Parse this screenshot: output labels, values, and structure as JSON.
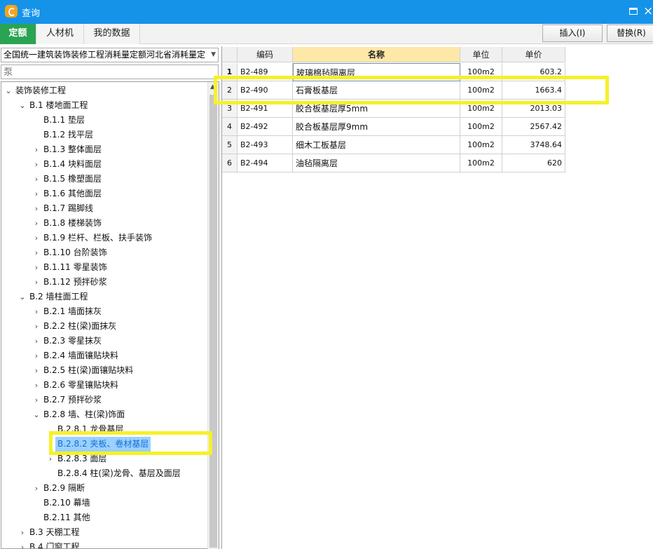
{
  "window": {
    "title": "查询"
  },
  "tabs": [
    "定额",
    "人材机",
    "我的数据"
  ],
  "buttons": {
    "insert": "插入(I)",
    "replace": "替换(R)"
  },
  "library": {
    "selected": "全国统一建筑装饰装修工程消耗量定额河北省消耗量定"
  },
  "search": {
    "value": "",
    "placeholder": "泵"
  },
  "tree": [
    {
      "label": "装饰装修工程",
      "level": 0,
      "arrow": "down"
    },
    {
      "label": "B.1 楼地面工程",
      "level": 1,
      "arrow": "down"
    },
    {
      "label": "B.1.1 垫层",
      "level": 2,
      "arrow": "none"
    },
    {
      "label": "B.1.2 找平层",
      "level": 2,
      "arrow": "none"
    },
    {
      "label": "B.1.3 整体面层",
      "level": 2,
      "arrow": "right"
    },
    {
      "label": "B.1.4 块料面层",
      "level": 2,
      "arrow": "right"
    },
    {
      "label": "B.1.5 橡塑面层",
      "level": 2,
      "arrow": "right"
    },
    {
      "label": "B.1.6 其他面层",
      "level": 2,
      "arrow": "right"
    },
    {
      "label": "B.1.7 踢脚线",
      "level": 2,
      "arrow": "right"
    },
    {
      "label": "B.1.8 楼梯装饰",
      "level": 2,
      "arrow": "right"
    },
    {
      "label": "B.1.9 栏杆、栏板、扶手装饰",
      "level": 2,
      "arrow": "right"
    },
    {
      "label": "B.1.10 台阶装饰",
      "level": 2,
      "arrow": "right"
    },
    {
      "label": "B.1.11 零星装饰",
      "level": 2,
      "arrow": "right"
    },
    {
      "label": "B.1.12 预拌砂浆",
      "level": 2,
      "arrow": "right"
    },
    {
      "label": "B.2 墙柱面工程",
      "level": 1,
      "arrow": "down"
    },
    {
      "label": "B.2.1 墙面抹灰",
      "level": 2,
      "arrow": "right"
    },
    {
      "label": "B.2.2 柱(梁)面抹灰",
      "level": 2,
      "arrow": "right"
    },
    {
      "label": "B.2.3 零星抹灰",
      "level": 2,
      "arrow": "right"
    },
    {
      "label": "B.2.4 墙面镶贴块料",
      "level": 2,
      "arrow": "right"
    },
    {
      "label": "B.2.5 柱(梁)面镶贴块料",
      "level": 2,
      "arrow": "right"
    },
    {
      "label": "B.2.6 零星镶贴块料",
      "level": 2,
      "arrow": "right"
    },
    {
      "label": "B.2.7 预拌砂浆",
      "level": 2,
      "arrow": "right"
    },
    {
      "label": "B.2.8 墙、柱(梁)饰面",
      "level": 2,
      "arrow": "down"
    },
    {
      "label": "B.2.8.1 龙骨基层",
      "level": 3,
      "arrow": "none"
    },
    {
      "label": "B.2.8.2 夹板、卷材基层",
      "level": 3,
      "arrow": "none",
      "selected": true
    },
    {
      "label": "B.2.8.3 面层",
      "level": 3,
      "arrow": "right"
    },
    {
      "label": "B.2.8.4 柱(梁)龙骨、基层及面层",
      "level": 3,
      "arrow": "none"
    },
    {
      "label": "B.2.9 隔断",
      "level": 2,
      "arrow": "right"
    },
    {
      "label": "B.2.10 幕墙",
      "level": 2,
      "arrow": "none"
    },
    {
      "label": "B.2.11 其他",
      "level": 2,
      "arrow": "none"
    },
    {
      "label": "B.3 天棚工程",
      "level": 1,
      "arrow": "right"
    },
    {
      "label": "B.4 门窗工程",
      "level": 1,
      "arrow": "right"
    }
  ],
  "table": {
    "columns": [
      "编码",
      "名称",
      "单位",
      "单价"
    ],
    "rows": [
      {
        "no": "1",
        "code": "B2-489",
        "name": "玻璃棉毡隔离层",
        "unit": "100m2",
        "price": "603.2"
      },
      {
        "no": "2",
        "code": "B2-490",
        "name": "石膏板基层",
        "unit": "100m2",
        "price": "1663.4"
      },
      {
        "no": "3",
        "code": "B2-491",
        "name": "胶合板基层厚5mm",
        "unit": "100m2",
        "price": "2013.03"
      },
      {
        "no": "4",
        "code": "B2-492",
        "name": "胶合板基层厚9mm",
        "unit": "100m2",
        "price": "2567.42"
      },
      {
        "no": "5",
        "code": "B2-493",
        "name": "细木工板基层",
        "unit": "100m2",
        "price": "3748.64"
      },
      {
        "no": "6",
        "code": "B2-494",
        "name": "油毡隔离层",
        "unit": "100m2",
        "price": "620"
      }
    ]
  },
  "colors": {
    "titlebar": "#1493e9",
    "active_tab": "#2aa352",
    "highlight": "#f7f02a",
    "selection": "#99d1ff"
  }
}
